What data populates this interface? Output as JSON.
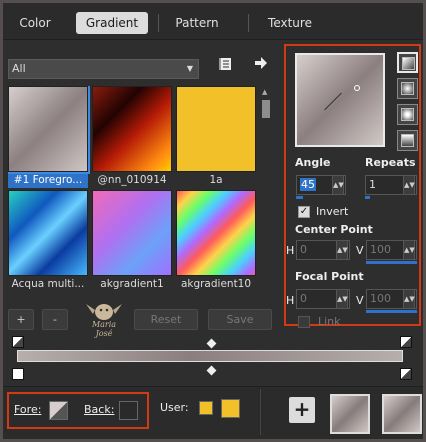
{
  "tabs": [
    {
      "label": "Color"
    },
    {
      "label": "Gradient"
    },
    {
      "label": "Pattern"
    },
    {
      "label": "Texture"
    }
  ],
  "filter": {
    "value": "All"
  },
  "gradients": [
    {
      "name": "#1 Foregro...",
      "bg": "linear-gradient(135deg,#d6cecd 0%,#8c8080 50%,#cfc6c4 100%)"
    },
    {
      "name": "@nn_010914",
      "bg": "linear-gradient(135deg,#8a1c0c 0%,#220303 30%,#b41a06 55%,#ff8a10 85%,#ffd000 100%)"
    },
    {
      "name": "1a",
      "bg": "#f2c12a"
    },
    {
      "name": "Acqua multi...",
      "bg": "linear-gradient(135deg,#28d0c0 0%,#1058c0 30%,#6ad0ff 50%,#0a3ca0 70%,#48b8ff 100%)"
    },
    {
      "name": "akgradient1",
      "bg": "linear-gradient(135deg,#f06ab8 0%,#b070f0 40%,#6ca0f8 70%,#a070ff 100%)"
    },
    {
      "name": "akgradient10",
      "bg": "repeating-linear-gradient(135deg,#ff5a5a 0px,#ffd24a 12px,#6aff6a 24px,#4ad0ff 36px,#b06aff 48px,#ff5a5a 60px)"
    }
  ],
  "buttons": {
    "add": "+",
    "remove": "-",
    "reset": "Reset",
    "save": "Save"
  },
  "logo_text": "Maria José",
  "settings": {
    "angle_label": "Angle",
    "angle_value": "45",
    "repeats_label": "Repeats",
    "repeats_value": "1",
    "invert_label": "Invert",
    "invert_checked": true,
    "center_point_label": "Center Point",
    "center_h_label": "H",
    "center_h_value": "0",
    "center_v_label": "V",
    "center_v_value": "100",
    "focal_point_label": "Focal Point",
    "focal_h_label": "H",
    "focal_h_value": "0",
    "focal_v_label": "V",
    "focal_v_value": "100",
    "link_label": "Link",
    "link_checked": false
  },
  "bottom": {
    "fore_label": "Fore:",
    "back_label": "Back:",
    "user_label": "User:",
    "add_button": "+"
  },
  "colors": {
    "accent": "#2f73c9",
    "highlight_border": "#d23a14",
    "user_swatch_1": "#f2c12a",
    "user_swatch_2": "#f2c12a",
    "back_swatch": "#2a2a2a"
  }
}
